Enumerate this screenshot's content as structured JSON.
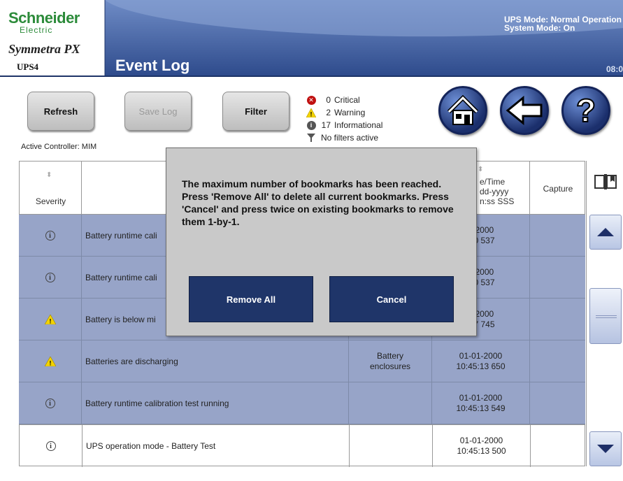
{
  "header": {
    "brand": "Schneider",
    "brand_sub": "Electric",
    "product": "Symmetra PX",
    "device": "UPS4",
    "page_title": "Event Log",
    "ups_mode": "UPS Mode: Normal Operation",
    "system_mode": "System Mode: On",
    "clock": "08:0",
    "header_color": "#3c5a9a"
  },
  "toolbar": {
    "refresh_label": "Refresh",
    "save_log_label": "Save Log",
    "filter_label": "Filter",
    "active_controller": "Active Controller: MIM"
  },
  "summary": {
    "critical_count": "0",
    "critical_label": "Critical",
    "warning_count": "2",
    "warning_label": "Warning",
    "info_count": "17",
    "info_label": "Informational",
    "filters": "No filters active"
  },
  "nav": {
    "home_icon": "home-icon",
    "back_icon": "back-arrow-icon",
    "help_icon": "help-icon"
  },
  "table": {
    "headers": {
      "severity": "Severity",
      "datetime_l1": "e/Time",
      "datetime_l2": "dd-yyyy",
      "datetime_l3": "n:ss SSS",
      "capture": "Capture"
    },
    "rows": [
      {
        "severity": "info",
        "desc": "Battery runtime cali",
        "device": "",
        "date": "1-2000",
        "time": ":30 537"
      },
      {
        "severity": "info",
        "desc": "Battery runtime cali",
        "device": "",
        "date": "1-2000",
        "time": ":30 537"
      },
      {
        "severity": "warning",
        "desc": "Battery is below mi",
        "device": "",
        "date": "1-2000",
        "time": ":07 745"
      },
      {
        "severity": "warning",
        "desc": "Batteries are discharging",
        "device_l1": "Battery",
        "device_l2": "enclosures",
        "date": "01-01-2000",
        "time": "10:45:13 650"
      },
      {
        "severity": "info",
        "desc": "Battery runtime calibration test running",
        "device": "",
        "date": "01-01-2000",
        "time": "10:45:13 549"
      },
      {
        "severity": "info",
        "desc": "UPS operation mode - Battery Test",
        "device": "",
        "date": "01-01-2000",
        "time": "10:45:13 500"
      }
    ],
    "row_highlight_color": "#97a4c8"
  },
  "dialog": {
    "message": "The maximum number of bookmarks has been reached. Press 'Remove All' to delete all current bookmarks. Press 'Cancel' and press twice on existing bookmarks to remove them 1-by-1.",
    "remove_all_label": "Remove All",
    "cancel_label": "Cancel"
  }
}
